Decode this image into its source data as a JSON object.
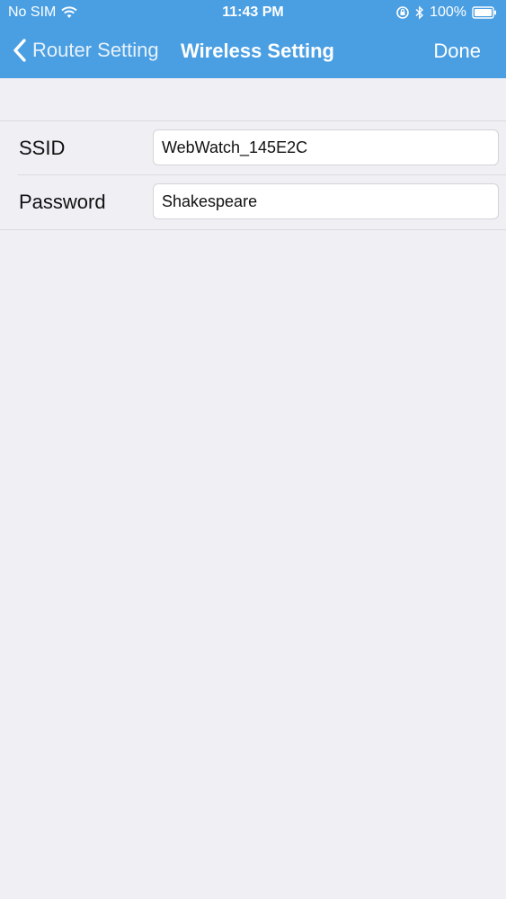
{
  "status_bar": {
    "carrier": "No SIM",
    "time": "11:43 PM",
    "battery": "100%",
    "icons": [
      "wifi-icon",
      "orientation-lock-icon",
      "bluetooth-icon",
      "battery-icon"
    ]
  },
  "nav_bar": {
    "back_label": "Router Setting",
    "title": "Wireless Setting",
    "done_label": "Done",
    "color": "#4a9fe3"
  },
  "form": {
    "ssid": {
      "label": "SSID",
      "value": "WebWatch_145E2C"
    },
    "password": {
      "label": "Password",
      "value": "Shakespeare"
    }
  },
  "colors": {
    "accent": "#4a9fe3",
    "background": "#efeff4"
  }
}
